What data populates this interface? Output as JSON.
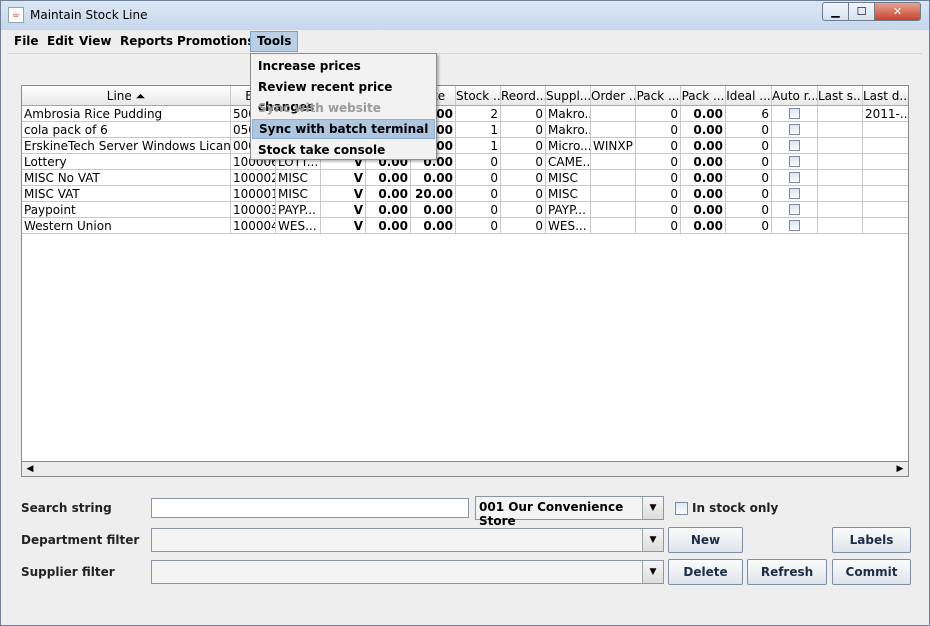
{
  "window": {
    "title": "Maintain Stock Line"
  },
  "menubar": [
    "File",
    "Edit",
    "View",
    "Reports",
    "Promotions",
    "Tools"
  ],
  "tools_menu": [
    {
      "label": "Increase prices",
      "state": "normal"
    },
    {
      "label": "Review recent price changes",
      "state": "normal"
    },
    {
      "label": "Sync with website",
      "state": "disabled"
    },
    {
      "label": "Sync with batch terminal",
      "state": "highlighted"
    },
    {
      "label": "Stock take console",
      "state": "normal"
    }
  ],
  "table": {
    "columns": [
      "Line ⏶",
      "Ba",
      "",
      "",
      "rate",
      "Stock ...",
      "Reord...",
      "Suppl...",
      "Order ...",
      "Pack ...",
      "Pack ...",
      "Ideal ...",
      "Auto r...",
      "Last s...",
      "Last d..."
    ],
    "rows": [
      [
        "Ambrosia Rice Pudding",
        "500",
        "",
        "",
        ".00",
        "2",
        "0",
        "Makro...",
        "",
        "0",
        "0.00",
        "6",
        "",
        "",
        "2011-..."
      ],
      [
        "cola pack of 6",
        "050",
        "",
        "",
        ".00",
        "1",
        "0",
        "Makro...",
        "",
        "0",
        "0.00",
        "0",
        "",
        "",
        ""
      ],
      [
        "ErskineTech Server Windows Lican...",
        "000",
        "",
        "",
        ".00",
        "1",
        "0",
        "Micro...",
        "WINXP",
        "0",
        "0.00",
        "0",
        "",
        "",
        ""
      ],
      [
        "Lottery",
        "100006",
        "LOTT...",
        "V",
        "0.00",
        "0",
        "0",
        "CAME...",
        "",
        "0",
        "0.00",
        "0",
        "",
        "",
        ""
      ],
      [
        "MISC No VAT",
        "100002",
        "MISC",
        "V",
        "0.00",
        "0",
        "0",
        "MISC",
        "",
        "0",
        "0.00",
        "0",
        "",
        "",
        ""
      ],
      [
        "MISC VAT",
        "100001",
        "MISC",
        "V",
        "0.00",
        "0",
        "0",
        "MISC",
        "",
        "0",
        "0.00",
        "0",
        "",
        "",
        ""
      ],
      [
        "Paypoint",
        "100003",
        "PAYP...",
        "V",
        "0.00",
        "0",
        "0",
        "PAYP...",
        "",
        "0",
        "0.00",
        "0",
        "",
        "",
        ""
      ],
      [
        "Western Union",
        "100004",
        "WES...",
        "V",
        "0.00",
        "0",
        "0",
        "WES...",
        "",
        "0",
        "0.00",
        "0",
        "",
        "",
        ""
      ]
    ],
    "extra_zero_col": [
      "",
      "",
      "",
      "0.00",
      "0.00",
      "0.00",
      "0.00",
      "0.00"
    ],
    "rate_col_full": [
      ".00",
      ".00",
      ".00",
      "0.00",
      "0.00",
      "20.00",
      "0.00",
      "0.00"
    ]
  },
  "filters": {
    "search_label": "Search string",
    "search_value": "",
    "store_selected": "001 Our Convenience Store",
    "in_stock_label": "In stock only",
    "department_label": "Department filter",
    "department_value": "",
    "supplier_label": "Supplier filter",
    "supplier_value": ""
  },
  "buttons": {
    "new": "New",
    "labels": "Labels",
    "delete": "Delete",
    "refresh": "Refresh",
    "commit": "Commit"
  }
}
